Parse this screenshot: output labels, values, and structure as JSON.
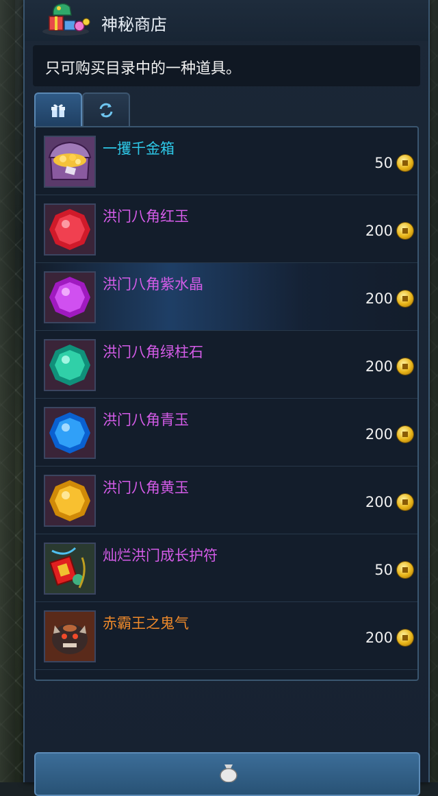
{
  "window": {
    "title": "神秘商店",
    "title_icon": "gift-bag-icon",
    "description": "只可购买目录中的一种道具。"
  },
  "tabs": [
    {
      "icon": "gift-box-icon",
      "active": true
    },
    {
      "icon": "refresh-icon",
      "active": false
    }
  ],
  "colors": {
    "cyan_name": "#2ec9e8",
    "purple_name": "#d45ce8",
    "orange_name": "#f08a2a",
    "coin": "#e8b418"
  },
  "items": [
    {
      "name": "一攫千金箱",
      "price": "50",
      "icon": "treasure-chest-icon",
      "name_color": "#2ec9e8"
    },
    {
      "name": "洪门八角红玉",
      "price": "200",
      "icon": "red-gem-icon",
      "name_color": "#d45ce8"
    },
    {
      "name": "洪门八角紫水晶",
      "price": "200",
      "icon": "purple-gem-icon",
      "name_color": "#d45ce8"
    },
    {
      "name": "洪门八角绿柱石",
      "price": "200",
      "icon": "green-gem-icon",
      "name_color": "#d45ce8"
    },
    {
      "name": "洪门八角青玉",
      "price": "200",
      "icon": "blue-gem-icon",
      "name_color": "#d45ce8"
    },
    {
      "name": "洪门八角黄玉",
      "price": "200",
      "icon": "yellow-gem-icon",
      "name_color": "#d45ce8"
    },
    {
      "name": "灿烂洪门成长护符",
      "price": "50",
      "icon": "talisman-icon",
      "name_color": "#d45ce8"
    },
    {
      "name": "赤霸王之鬼气",
      "price": "200",
      "icon": "demon-beast-icon",
      "name_color": "#f08a2a"
    }
  ],
  "bottom_button": {
    "icon": "money-bag-icon"
  }
}
